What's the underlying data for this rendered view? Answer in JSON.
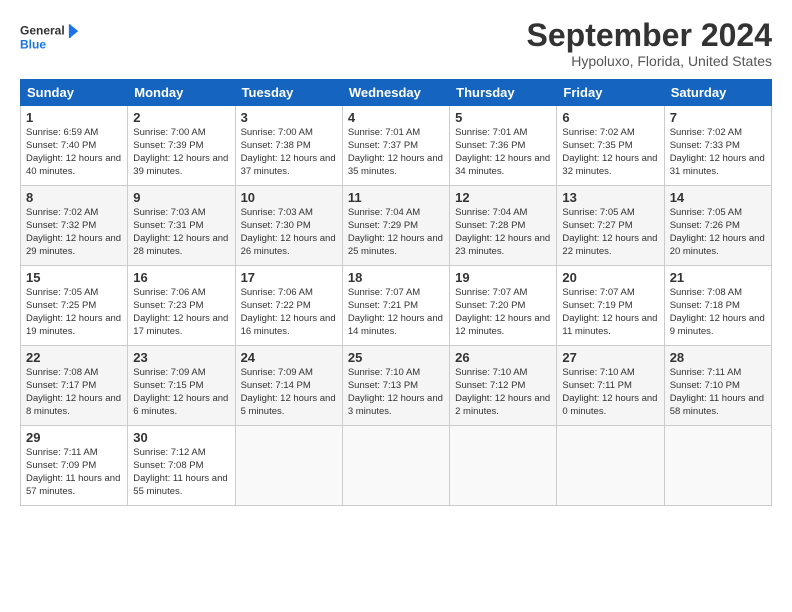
{
  "logo": {
    "line1": "General",
    "line2": "Blue"
  },
  "title": "September 2024",
  "subtitle": "Hypoluxo, Florida, United States",
  "weekdays": [
    "Sunday",
    "Monday",
    "Tuesday",
    "Wednesday",
    "Thursday",
    "Friday",
    "Saturday"
  ],
  "weeks": [
    [
      {
        "day": 1,
        "sunrise": "6:59 AM",
        "sunset": "7:40 PM",
        "daylight": "12 hours and 40 minutes."
      },
      {
        "day": 2,
        "sunrise": "7:00 AM",
        "sunset": "7:39 PM",
        "daylight": "12 hours and 39 minutes."
      },
      {
        "day": 3,
        "sunrise": "7:00 AM",
        "sunset": "7:38 PM",
        "daylight": "12 hours and 37 minutes."
      },
      {
        "day": 4,
        "sunrise": "7:01 AM",
        "sunset": "7:37 PM",
        "daylight": "12 hours and 35 minutes."
      },
      {
        "day": 5,
        "sunrise": "7:01 AM",
        "sunset": "7:36 PM",
        "daylight": "12 hours and 34 minutes."
      },
      {
        "day": 6,
        "sunrise": "7:02 AM",
        "sunset": "7:35 PM",
        "daylight": "12 hours and 32 minutes."
      },
      {
        "day": 7,
        "sunrise": "7:02 AM",
        "sunset": "7:33 PM",
        "daylight": "12 hours and 31 minutes."
      }
    ],
    [
      {
        "day": 8,
        "sunrise": "7:02 AM",
        "sunset": "7:32 PM",
        "daylight": "12 hours and 29 minutes."
      },
      {
        "day": 9,
        "sunrise": "7:03 AM",
        "sunset": "7:31 PM",
        "daylight": "12 hours and 28 minutes."
      },
      {
        "day": 10,
        "sunrise": "7:03 AM",
        "sunset": "7:30 PM",
        "daylight": "12 hours and 26 minutes."
      },
      {
        "day": 11,
        "sunrise": "7:04 AM",
        "sunset": "7:29 PM",
        "daylight": "12 hours and 25 minutes."
      },
      {
        "day": 12,
        "sunrise": "7:04 AM",
        "sunset": "7:28 PM",
        "daylight": "12 hours and 23 minutes."
      },
      {
        "day": 13,
        "sunrise": "7:05 AM",
        "sunset": "7:27 PM",
        "daylight": "12 hours and 22 minutes."
      },
      {
        "day": 14,
        "sunrise": "7:05 AM",
        "sunset": "7:26 PM",
        "daylight": "12 hours and 20 minutes."
      }
    ],
    [
      {
        "day": 15,
        "sunrise": "7:05 AM",
        "sunset": "7:25 PM",
        "daylight": "12 hours and 19 minutes."
      },
      {
        "day": 16,
        "sunrise": "7:06 AM",
        "sunset": "7:23 PM",
        "daylight": "12 hours and 17 minutes."
      },
      {
        "day": 17,
        "sunrise": "7:06 AM",
        "sunset": "7:22 PM",
        "daylight": "12 hours and 16 minutes."
      },
      {
        "day": 18,
        "sunrise": "7:07 AM",
        "sunset": "7:21 PM",
        "daylight": "12 hours and 14 minutes."
      },
      {
        "day": 19,
        "sunrise": "7:07 AM",
        "sunset": "7:20 PM",
        "daylight": "12 hours and 12 minutes."
      },
      {
        "day": 20,
        "sunrise": "7:07 AM",
        "sunset": "7:19 PM",
        "daylight": "12 hours and 11 minutes."
      },
      {
        "day": 21,
        "sunrise": "7:08 AM",
        "sunset": "7:18 PM",
        "daylight": "12 hours and 9 minutes."
      }
    ],
    [
      {
        "day": 22,
        "sunrise": "7:08 AM",
        "sunset": "7:17 PM",
        "daylight": "12 hours and 8 minutes."
      },
      {
        "day": 23,
        "sunrise": "7:09 AM",
        "sunset": "7:15 PM",
        "daylight": "12 hours and 6 minutes."
      },
      {
        "day": 24,
        "sunrise": "7:09 AM",
        "sunset": "7:14 PM",
        "daylight": "12 hours and 5 minutes."
      },
      {
        "day": 25,
        "sunrise": "7:10 AM",
        "sunset": "7:13 PM",
        "daylight": "12 hours and 3 minutes."
      },
      {
        "day": 26,
        "sunrise": "7:10 AM",
        "sunset": "7:12 PM",
        "daylight": "12 hours and 2 minutes."
      },
      {
        "day": 27,
        "sunrise": "7:10 AM",
        "sunset": "7:11 PM",
        "daylight": "12 hours and 0 minutes."
      },
      {
        "day": 28,
        "sunrise": "7:11 AM",
        "sunset": "7:10 PM",
        "daylight": "11 hours and 58 minutes."
      }
    ],
    [
      {
        "day": 29,
        "sunrise": "7:11 AM",
        "sunset": "7:09 PM",
        "daylight": "11 hours and 57 minutes."
      },
      {
        "day": 30,
        "sunrise": "7:12 AM",
        "sunset": "7:08 PM",
        "daylight": "11 hours and 55 minutes."
      },
      null,
      null,
      null,
      null,
      null
    ]
  ],
  "labels": {
    "sunrise_prefix": "Sunrise: ",
    "sunset_prefix": "Sunset: ",
    "daylight_prefix": "Daylight: "
  }
}
